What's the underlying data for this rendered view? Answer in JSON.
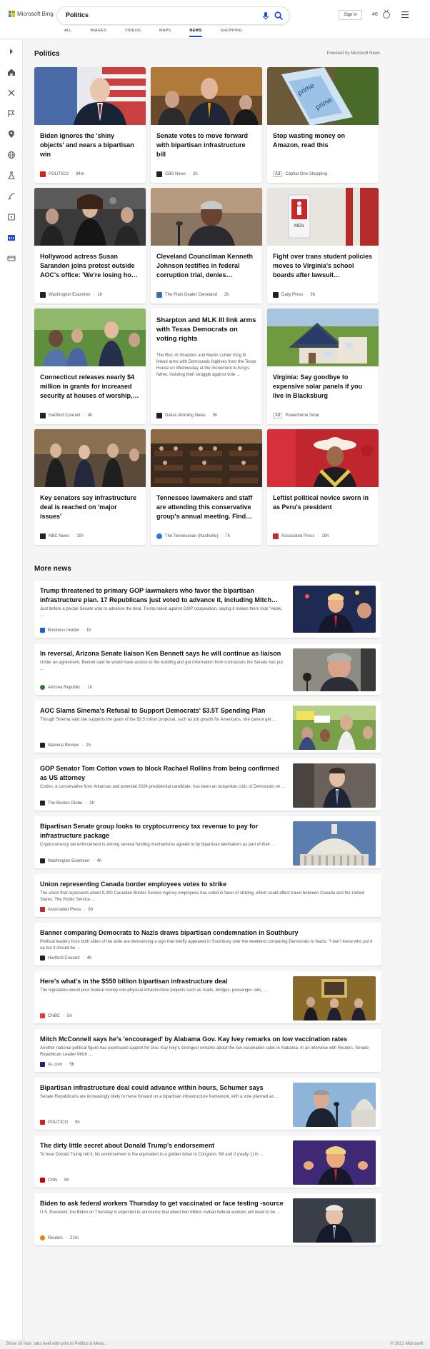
{
  "header": {
    "brand": "Microsoft Bing",
    "query": "Politics",
    "signin": "Sign in",
    "points": "40",
    "tabs": [
      "ALL",
      "IMAGES",
      "VIDEOS",
      "MAPS",
      "NEWS",
      "SHOPPING"
    ],
    "active_tab": "NEWS"
  },
  "colors": {
    "accent": "#174ae4",
    "bg": "#f5f5f5"
  },
  "section": {
    "title": "Politics",
    "powered": "Powered by Microsoft News"
  },
  "cards": [
    {
      "title": "Biden ignores the 'shiny objects' and nears a bipartisan win",
      "source": "POLITICO",
      "age": "34m",
      "fav": "#d91c1c"
    },
    {
      "title": "Senate votes to move forward with bipartisan infrastructure bill",
      "source": "CBS News",
      "age": "2h",
      "fav": "#222"
    },
    {
      "title": "Stop wasting money on Amazon, read this",
      "source": "Capital One Shopping",
      "age": "",
      "ad": "Ad",
      "fav": "#fff"
    },
    {
      "title": "Hollywood actress Susan Sarandon joins protest outside AOC's office: 'We're losing ho…",
      "source": "Washington Examiner",
      "age": "1h",
      "fav": "#222"
    },
    {
      "title": "Cleveland Councilman Kenneth Johnson testifies in federal corruption trial, denies…",
      "source": "The Plain Dealer Cleveland",
      "age": "2h",
      "fav": "#3b6fb6"
    },
    {
      "title": "Fight over trans student policies moves to Virginia's school boards after lawsuit…",
      "source": "Daily Press",
      "age": "3h",
      "fav": "#222"
    },
    {
      "title": "Connecticut releases nearly $4 million in grants for increased security at houses of worship,…",
      "source": "Hartford Courant",
      "age": "4h",
      "fav": "#222"
    },
    {
      "title": "Sharpton and MLK III link arms with Texas Democrats on voting rights",
      "snippet": "The Rev. Al Sharpton and Martin Luther King III linked arms with Democratic fugitives from the Texas House on Wednesday at the monument to King's father, insisting their struggle against vote ...",
      "source": "Dallas Morning News",
      "age": "5h",
      "fav": "#222"
    },
    {
      "title": "Virginia: Say goodbye to expensive solar panels if you live in Blacksburg",
      "source": "Powerhome Solar",
      "age": "",
      "ad": "Ad",
      "fav": "#fff"
    },
    {
      "title": "Key senators say infrastructure deal is reached on 'major issues'",
      "source": "NBC News",
      "age": "10h",
      "fav": "#222"
    },
    {
      "title": "Tennessee lawmakers and staff are attending this conservative group's annual meeting. Find…",
      "source": "The Tennessean (Nashville)",
      "age": "7h",
      "fav": "#2f7bd1"
    },
    {
      "title": "Leftist political novice sworn in as Peru's president",
      "source": "Associated Press",
      "age": "10h",
      "fav": "#c62828"
    }
  ],
  "more_news": {
    "title": "More news",
    "items": [
      {
        "title": "Trump threatened to primary GOP lawmakers who favor the bipartisan infrastructure plan. 17 Republicans just voted to advance it, including Mitch…",
        "snippet": "Just before a pivotal Senate vote to advance the deal, Trump railed against GOP cooperation, saying it makes them look \"weak, ...",
        "source": "Business Insider",
        "age": "1h",
        "fav": "#1f5fd6"
      },
      {
        "title": "In reversal, Arizona Senate liaison Ken Bennett says he will continue as liaison",
        "snippet": "Under an agreement, Bennet said he would have access to the building and get information from contractors the Senate has put ...",
        "source": "Arizona Republic",
        "age": "1h",
        "fav": "#2e7d32"
      },
      {
        "title": "AOC Slams Sinema's Refusal to Support Democrats' $3.5T Spending Plan",
        "snippet": "Though Sinema said she supports the goals of the $3.5 trillion proposal, such as job growth for Americans, she cannot get ...",
        "source": "National Review",
        "age": "2h",
        "fav": "#222"
      },
      {
        "title": "GOP Senator Tom Cotton vows to block Rachael Rollins from being confirmed as US attorney",
        "snippet": "Cotton, a conservative from Arkansas and potential 2024 presidential candidate, has been an outspoken critic of Democrats on ...",
        "source": "The Boston Globe",
        "age": "2h",
        "fav": "#222"
      },
      {
        "title": "Bipartisan Senate group looks to cryptocurrency tax revenue to pay for infrastructure package",
        "snippet": "Cryptocurrency tax enforcement is among several funding mechanisms agreed to by bipartisan lawmakers as part of their ...",
        "source": "Washington Examiner",
        "age": "4h",
        "fav": "#222"
      },
      {
        "title": "Union representing Canada border employees votes to strike",
        "snippet": "The union that represents about 9,000 Canadian Border Service Agency employees has voted in favor of striking, which could affect travel between Canada and the United States. The Public Service ...",
        "source": "Associated Press",
        "age": "6h",
        "fav": "#c62828"
      },
      {
        "title": "Banner comparing Democrats to Nazis draws bipartisan condemnation in Southbury",
        "snippet": "Political leaders from both sides of the aisle are denouncing a sign that briefly appeared in Southbury over the weekend comparing Democrats to Nazis. \"I don't know who put it up but it should be ...",
        "source": "Hartford Courant",
        "age": "4h",
        "fav": "#222"
      },
      {
        "title": "Here's what's in the $550 billion bipartisan infrastructure deal",
        "snippet": "The legislation would pour federal money into physical infrastructure projects such as roads, bridges, passenger rails, ...",
        "source": "CNBC",
        "age": "5h",
        "fav": "#e53935"
      },
      {
        "title": "Mitch McConnell says he's 'encouraged' by Alabama Gov. Kay Ivey remarks on low vaccination rates",
        "snippet": "Another national political figure has expressed support for Gov. Kay Ivey's strongest remarks about the low vaccination rates in Alabama. In an interview with Reuters, Senate Republican Leader Mitch ...",
        "source": "AL.com",
        "age": "5h",
        "fav": "#1a237e"
      },
      {
        "title": "Bipartisan infrastructure deal could advance within hours, Schumer says",
        "snippet": "Senate Republicans are increasingly likely to move forward on a bipartisan infrastructure framework, with a vote planned as ...",
        "source": "POLITICO",
        "age": "9h",
        "fav": "#d91c1c"
      },
      {
        "title": "The dirty little secret about Donald Trump's endorsement",
        "snippet": "To hear Donald Trump tell it, his endorsement is the equivalent to a golden ticket to Congress.\"88 and 2 (really 1) in ...",
        "source": "CNN",
        "age": "9h",
        "fav": "#cc0000"
      },
      {
        "title": "Biden to ask federal workers Thursday to get vaccinated or face testing -source",
        "snippet": "U.S. President Joe Biden on Thursday is expected to announce that about two million civilian federal workers will need to be ...",
        "source": "Reuters",
        "age": "21m",
        "fav": "#f57c00"
      }
    ]
  },
  "footer": {
    "left": "Show 10 Nov: tabs held with pols to Politics & Mora...",
    "right": "© 2021 Microsoft"
  }
}
